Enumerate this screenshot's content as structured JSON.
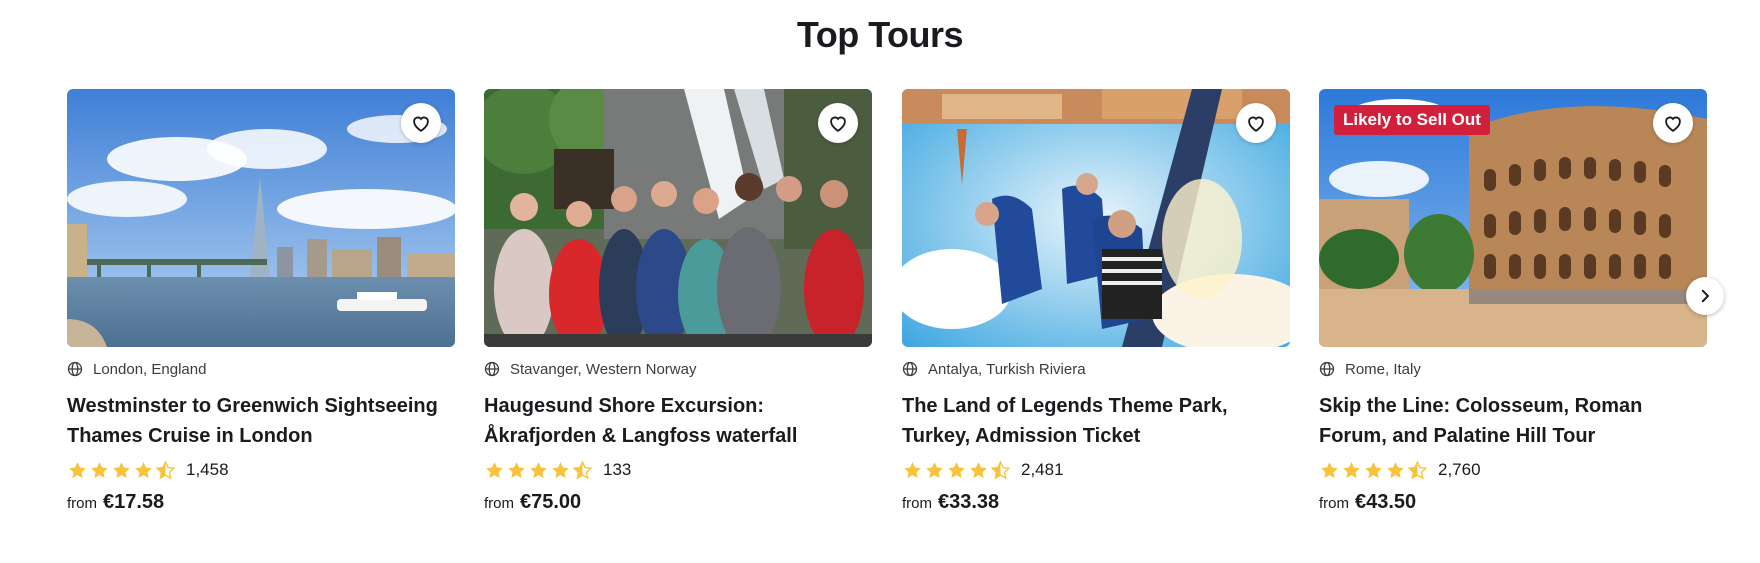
{
  "section": {
    "title": "Top Tours"
  },
  "tours": [
    {
      "location": "London, England",
      "title": "Westminster to Greenwich Sightseeing Thames Cruise in London",
      "rating": 4.5,
      "reviews": "1,458",
      "from_label": "from",
      "price": "€17.58",
      "badge": ""
    },
    {
      "location": "Stavanger, Western Norway",
      "title": "Haugesund Shore Excursion: Åkrafjorden & Langfoss waterfall",
      "rating": 4.5,
      "reviews": "133",
      "from_label": "from",
      "price": "€75.00",
      "badge": ""
    },
    {
      "location": "Antalya, Turkish Riviera",
      "title": "The Land of Legends Theme Park, Turkey, Admission Ticket",
      "rating": 4.5,
      "reviews": "2,481",
      "from_label": "from",
      "price": "€33.38",
      "badge": ""
    },
    {
      "location": "Rome, Italy",
      "title": "Skip the Line: Colosseum, Roman Forum, and Palatine Hill Tour",
      "rating": 4.5,
      "reviews": "2,760",
      "from_label": "from",
      "price": "€43.50",
      "badge": "Likely to Sell Out"
    }
  ],
  "icons": {
    "location": "globe-icon",
    "wishlist": "heart-icon",
    "rating": "star-icon",
    "carousel_next": "chevron-right-icon"
  },
  "colors": {
    "star": "#f8c33c",
    "badge": "#d21f3c",
    "text": "#1a1b1f"
  }
}
